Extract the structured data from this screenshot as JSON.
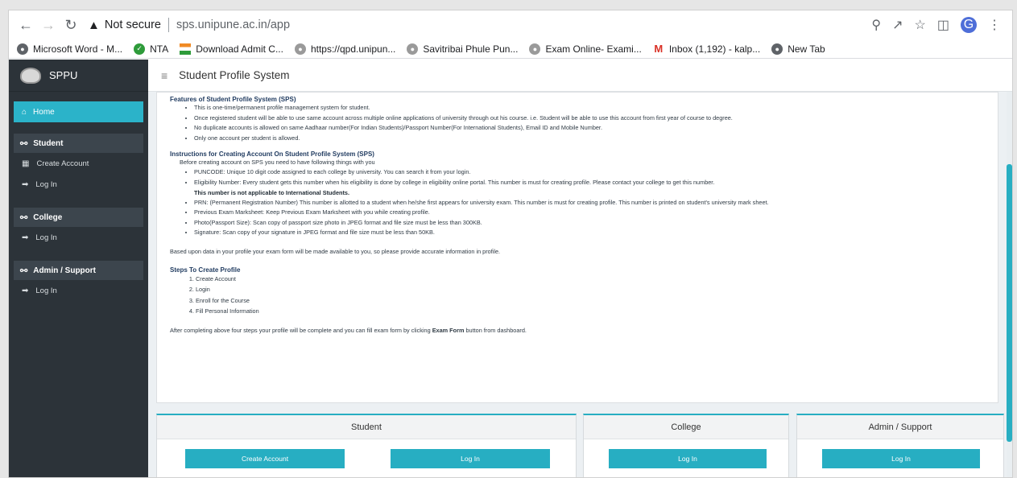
{
  "browser": {
    "not_secure": "Not secure",
    "url": "sps.unipune.ac.in/app",
    "avatar_letter": "G",
    "bookmarks": [
      {
        "label": "Microsoft Word - M...",
        "color": "#5f6368"
      },
      {
        "label": "NTA",
        "color": "#2e9b3a"
      },
      {
        "label": "Download Admit C...",
        "color": "#f08a24"
      },
      {
        "label": "https://qpd.unipun...",
        "color": "#8a8a8a"
      },
      {
        "label": "Savitribai Phule Pun...",
        "color": "#8a8a8a"
      },
      {
        "label": "Exam Online- Exami...",
        "color": "#8a8a8a"
      },
      {
        "label": "Inbox (1,192) - kalp...",
        "color": "#d93025"
      },
      {
        "label": "New Tab",
        "color": "#5f6368"
      }
    ]
  },
  "sidebar": {
    "brand": "SPPU",
    "home": "Home",
    "student_head": "Student",
    "student_create": "Create Account",
    "student_login": "Log In",
    "college_head": "College",
    "college_login": "Log In",
    "admin_head": "Admin / Support",
    "admin_login": "Log In"
  },
  "header": {
    "title": "Student Profile System"
  },
  "content": {
    "features_title": "Features of Student Profile System (SPS)",
    "features": [
      "This is one-time/permanent profile management system for student.",
      "Once registered student will be able to use same account across multiple online applications of university through out his course. i.e. Student will be able to use this account from first year of course to degree.",
      "No duplicate accounts is allowed on same Aadhaar number(For Indian Students)/Passport Number(For International Students), Email ID and Mobile Number.",
      "Only one account per student is allowed."
    ],
    "instructions_title": "Instructions for Creating Account On Student Profile System (SPS)",
    "instructions_intro": "Before creating account on SPS you need to have following things with you",
    "instr_1": "PUNCODE: Unique 10 digit code assigned to each college by university. You can search it from your login.",
    "instr_2": "Eligibility Number: Every student gets this number when his eligibility is done by college in eligibility online portal. This number is must for creating profile. Please contact your college to get this number.",
    "instr_2_note": "This number is not applicable to International Students.",
    "instr_rest": [
      "PRN: (Permanent Registration Number) This number is allotted to a student when he/she first appears for university exam.  This number is must for creating profile. This number is printed on student's university mark sheet.",
      "Previous Exam Marksheet: Keep Previous Exam Marksheet with you while creating profile.",
      "Photo(Passport Size): Scan copy of passport size photo in JPEG format and file size must be less than 300KB.",
      "Signature: Scan copy of your signature in JPEG format and file size must be less than 50KB."
    ],
    "based_upon": "Based upon data in your profile your exam form will be made available to you, so please provide accurate information in profile.",
    "steps_title": "Steps To Create Profile",
    "steps": [
      "Create Account",
      "Login",
      "Enroll for the Course",
      "Fill Personal Information"
    ],
    "closing_pre": "After completing above four steps your profile will be complete and you can fill exam form by clicking ",
    "closing_bold": "Exam Form",
    "closing_post": " button from dashboard."
  },
  "panels": {
    "student_title": "Student",
    "student_create": "Create Account",
    "student_login": "Log In",
    "college_title": "College",
    "college_login": "Log In",
    "admin_title": "Admin / Support",
    "admin_login": "Log In"
  }
}
